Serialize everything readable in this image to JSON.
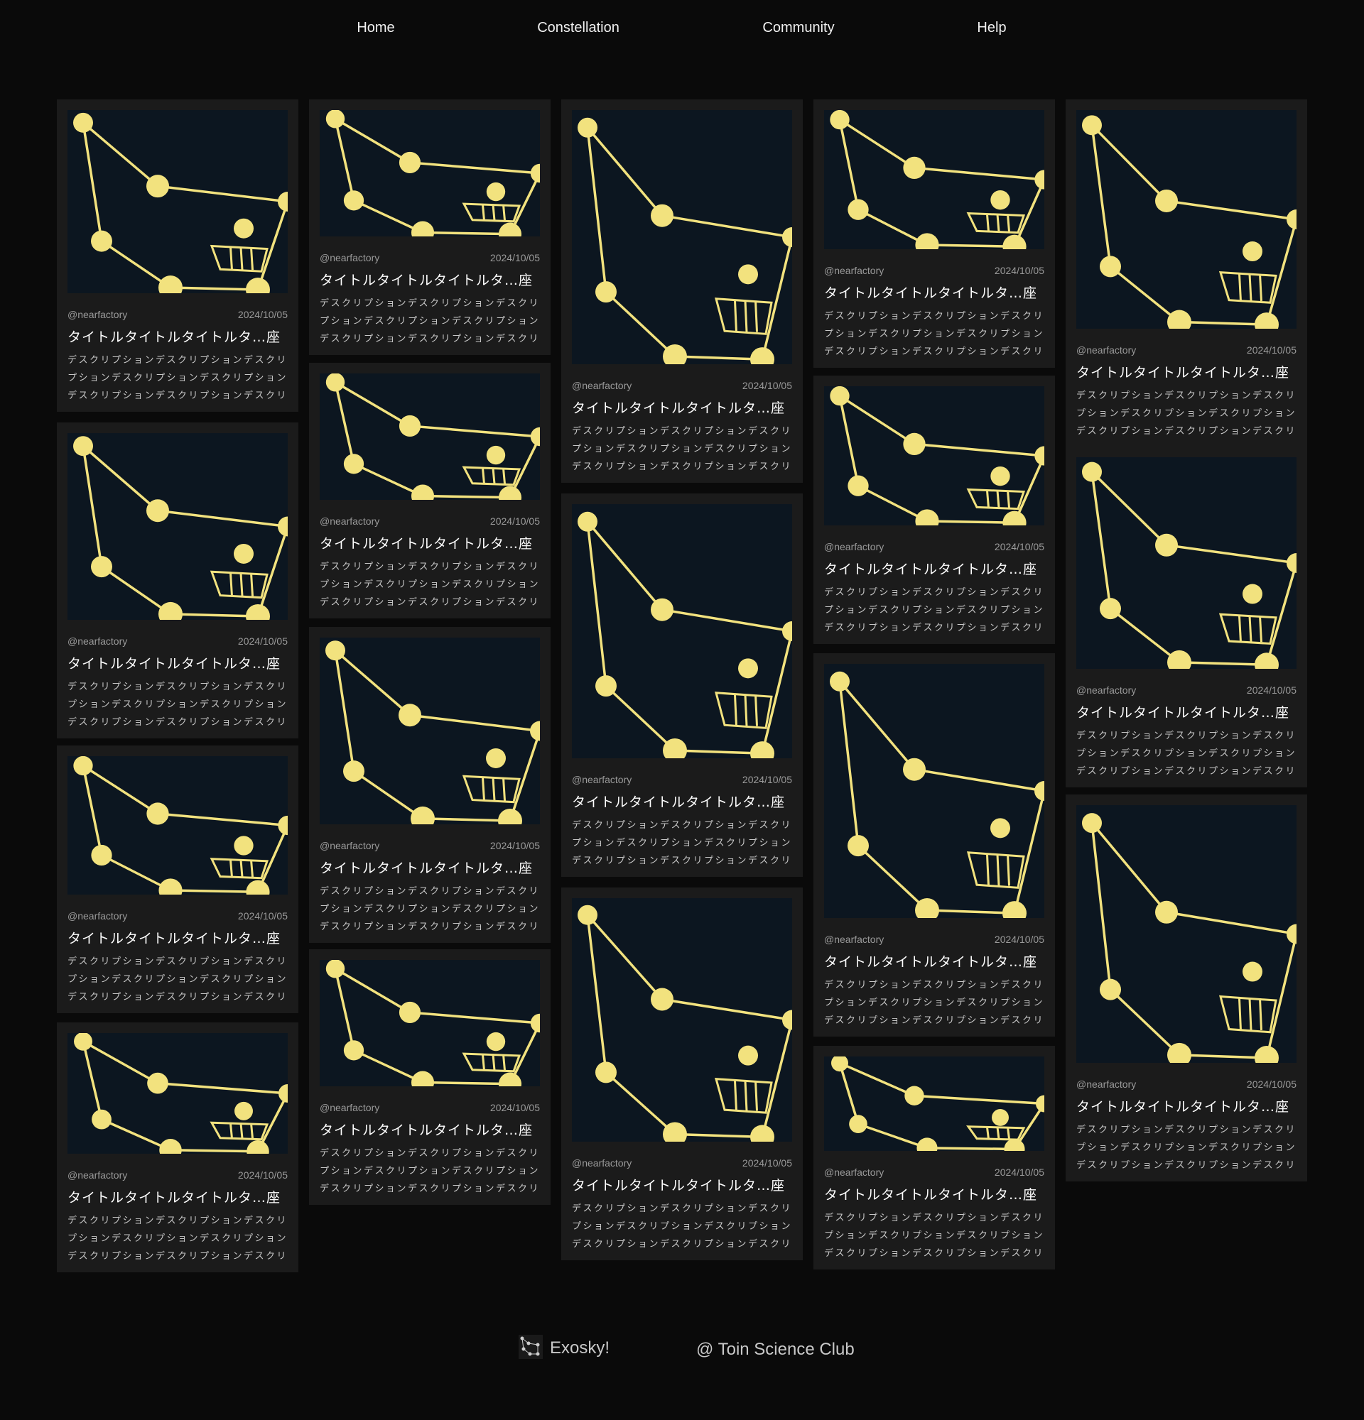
{
  "nav": {
    "home": "Home",
    "constellation": "Constellation",
    "community": "Community",
    "help": "Help"
  },
  "card": {
    "author": "@nearfactory",
    "date": "2024/10/05",
    "title": "タイトルタイトルタイトルタ…座",
    "description": "デスクリプションデスクリプションデスクリプションデスクリプションデスクリプションデスクリプションデスクリプションデスクリプショ"
  },
  "footer": {
    "brand": "Exosky!",
    "club": "@ Toin Science Club"
  },
  "colors": {
    "background": "#0a0a0a",
    "card": "#1b1b1b",
    "thumb": "#0c1620",
    "star": "#f2e27e"
  }
}
